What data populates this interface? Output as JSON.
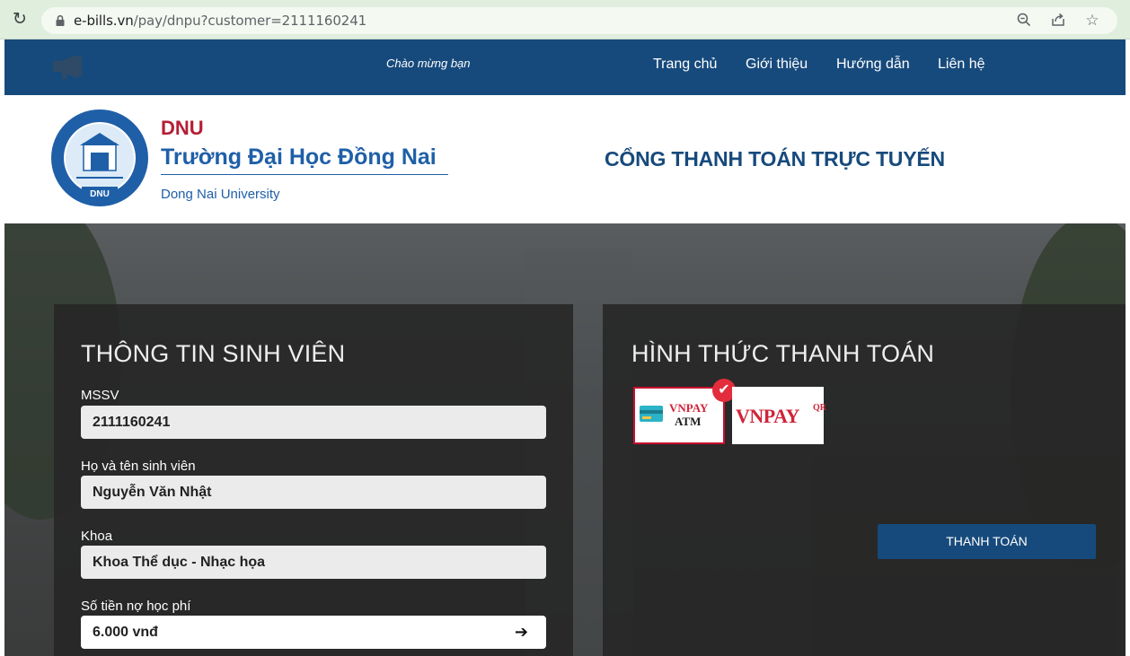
{
  "browser": {
    "url_host": "e-bills.vn",
    "url_path": "/pay/dnpu?customer=2111160241"
  },
  "topnav": {
    "welcome": "Chào mừng bạn",
    "links": [
      "Trang chủ",
      "Giới thiệu",
      "Hướng dẫn",
      "Liên hệ"
    ]
  },
  "header": {
    "short_name": "DNU",
    "name": "Trường Đại Học Đồng Nai",
    "english_name": "Dong Nai University",
    "logo_text": "DNU",
    "portal_title": "CỔNG THANH TOÁN TRỰC TUYẾN"
  },
  "student": {
    "title": "THÔNG TIN SINH VIÊN",
    "fields": [
      {
        "label": "MSSV",
        "value": "2111160241"
      },
      {
        "label": "Họ và tên sinh viên",
        "value": "Nguyễn Văn Nhật"
      },
      {
        "label": "Khoa",
        "value": "Khoa Thể dục - Nhạc họa"
      },
      {
        "label": "Số tiền nợ học phí",
        "value": "6.000 vnđ"
      }
    ]
  },
  "payment": {
    "title": "HÌNH THỨC THANH TOÁN",
    "options": [
      {
        "top": "VNPAY",
        "bottom": "ATM",
        "selected": true
      },
      {
        "brand": "VNPAY",
        "suffix": "QR",
        "selected": false
      }
    ],
    "button": "THANH TOÁN"
  },
  "colors": {
    "nav": "#174a7c",
    "brand_red": "#b51e36",
    "brand_blue": "#1f5fa8",
    "selected_border": "#c8102e"
  },
  "icons": [
    "reload-icon",
    "lock-icon",
    "zoom-icon",
    "share-icon",
    "star-icon",
    "megaphone-icon",
    "check-icon",
    "arrow-right-icon"
  ]
}
